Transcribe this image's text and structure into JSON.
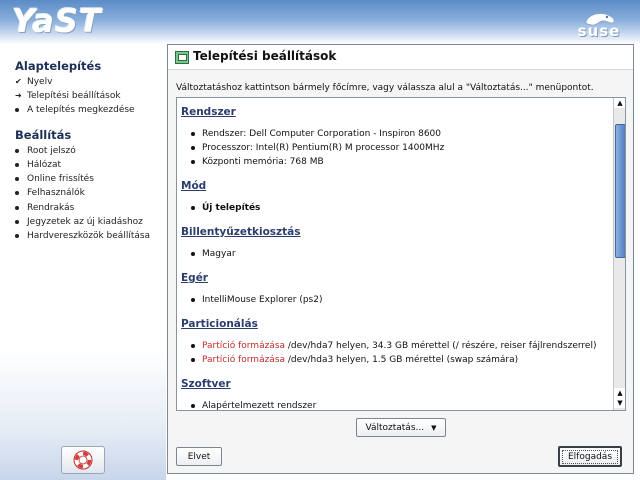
{
  "header": {
    "logo_text": "YaST",
    "brand_text": "suse"
  },
  "sidebar": {
    "section1_title": "Alaptelepítés",
    "section1_items": [
      {
        "label": "Nyelv",
        "state": "done",
        "mark": "✔"
      },
      {
        "label": "Telepítési beállítások",
        "state": "current",
        "mark": "➜"
      },
      {
        "label": "A telepítés megkezdése",
        "state": "pending"
      }
    ],
    "section2_title": "Beállítás",
    "section2_items": [
      {
        "label": "Root jelszó"
      },
      {
        "label": "Hálózat"
      },
      {
        "label": "Online frissítés"
      },
      {
        "label": "Felhasználók"
      },
      {
        "label": "Rendrakás"
      },
      {
        "label": "Jegyzetek az új kiadáshoz"
      },
      {
        "label": "Hardvereszközök beállítása"
      }
    ],
    "help_icon": "lifebuoy-icon"
  },
  "panel": {
    "title": "Telepítési beállítások",
    "title_icon": "settings-window-icon",
    "intro": "Változtatáshoz kattintson bármely főcímre, vagy válassza alul a \"Változtatás...\" menüpontot."
  },
  "summary": {
    "sections": [
      {
        "title": "Rendszer",
        "items": [
          {
            "text": "Rendszer: Dell Computer Corporation - Inspiron 8600"
          },
          {
            "text": "Processzor: Intel(R) Pentium(R) M processor 1400MHz"
          },
          {
            "text": "Központi memória: 768 MB"
          }
        ]
      },
      {
        "title": "Mód",
        "items": [
          {
            "text": "Új telepítés",
            "bold": true
          }
        ]
      },
      {
        "title": "Billentyűzetkiosztás",
        "items": [
          {
            "text": "Magyar"
          }
        ]
      },
      {
        "title": "Egér",
        "items": [
          {
            "text": "IntelliMouse Explorer (ps2)"
          }
        ]
      },
      {
        "title": "Particionálás",
        "items": [
          {
            "red": "Partíció formázása",
            "text": " /dev/hda7 helyen, 34.3 GB mérettel (/ részére, reiser fájlrendszerrel)"
          },
          {
            "red": "Partíció formázása",
            "text": " /dev/hda3 helyen, 1.5 GB mérettel (swap számára)"
          }
        ]
      },
      {
        "title": "Szoftver",
        "items": [
          {
            "text": "Alapértelmezett rendszer"
          }
        ]
      }
    ]
  },
  "buttons": {
    "change": "Változtatás...",
    "abort": "Elvet",
    "accept": "Elfogadás"
  },
  "colors": {
    "section_link": "#2a3d6d",
    "warning_red": "#c22c2c",
    "scroll_thumb": "#4f7fc0"
  }
}
